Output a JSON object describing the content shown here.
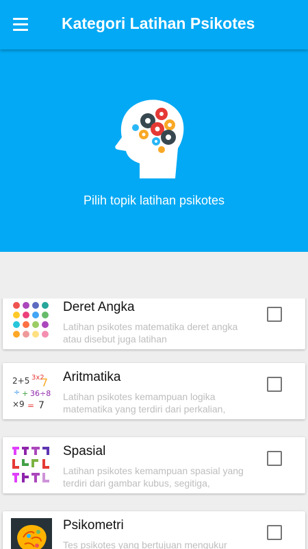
{
  "appbar": {
    "title": "Kategori Latihan Psikotes"
  },
  "hero": {
    "subtitle": "Pilih topik latihan psikotes"
  },
  "categories": [
    {
      "title": "Deret Angka",
      "desc": "Latihan psikotes matematika deret angka atau disebut juga latihan"
    },
    {
      "title": "Aritmatika",
      "desc": "Latihan psikotes kemampuan logika matematika yang terdiri dari perkalian,"
    },
    {
      "title": "Spasial",
      "desc": "Latihan psikotes kemampuan spasial yang terdiri dari gambar kubus, segitiga,"
    },
    {
      "title": "Psikometri",
      "desc": "Tes psikotes yang bertujuan mengukur kepribadian"
    }
  ],
  "colors": {
    "primary": "#03a9f4",
    "background": "#eeeeee",
    "card": "#ffffff"
  },
  "icons": {
    "menu": "hamburger-menu-icon",
    "hero": "head-gears-icon"
  }
}
